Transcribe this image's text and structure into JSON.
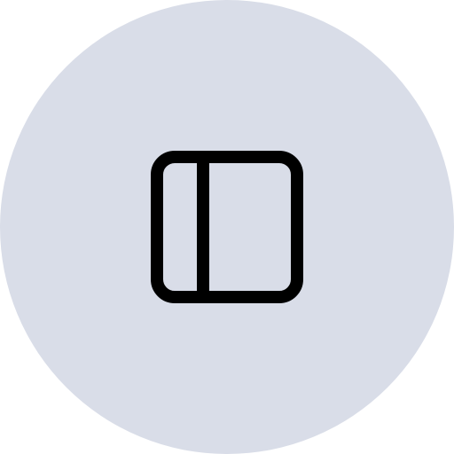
{
  "button": {
    "icon": "sidebar-panel-icon",
    "background_color": "#d9dde8",
    "icon_color": "#000000"
  }
}
